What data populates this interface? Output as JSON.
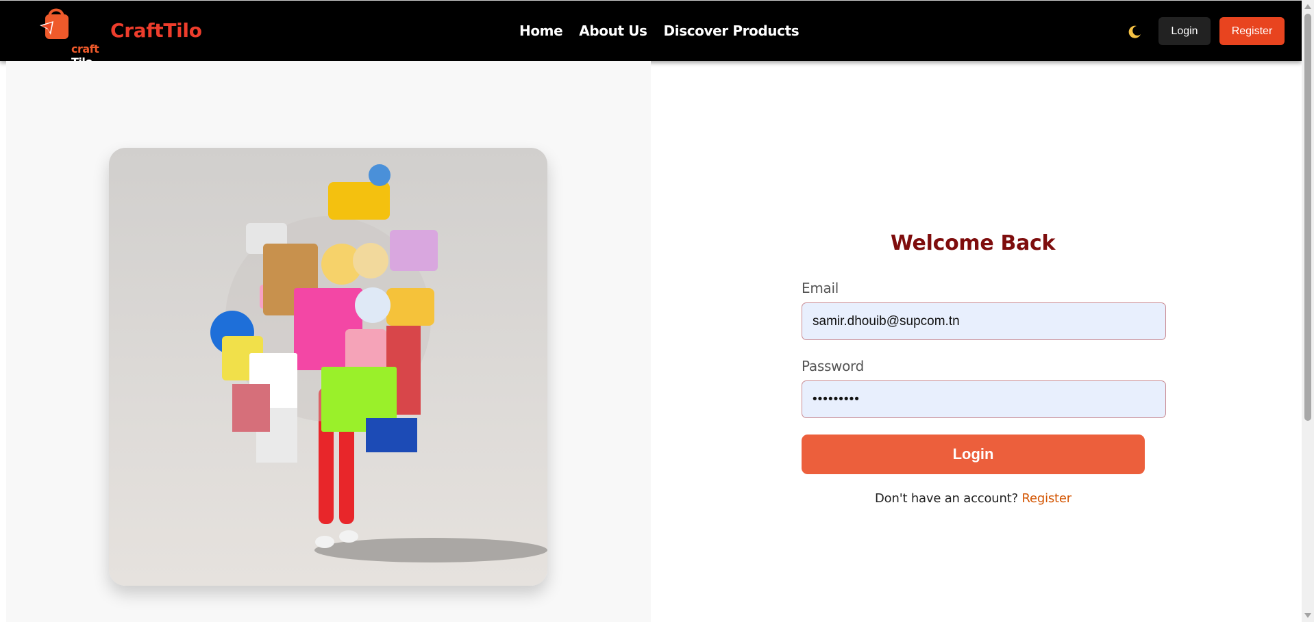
{
  "navbar": {
    "logo_text_1": "craft",
    "logo_text_2": "Tilo",
    "brand": "CraftTilo",
    "links": [
      "Home",
      "About Us",
      "Discover Products"
    ],
    "theme_icon": "moon-icon",
    "login_label": "Login",
    "register_label": "Register"
  },
  "hero": {
    "image": "shopping-bags-illustration"
  },
  "form": {
    "title": "Welcome Back",
    "email_label": "Email",
    "email_value": "samir.dhouib@supcom.tn",
    "password_label": "Password",
    "password_value": "•••••••••",
    "submit_label": "Login",
    "signup_prompt": "Don't have an account?",
    "signup_link": "Register"
  },
  "colors": {
    "navbar_bg": "#000000",
    "brand": "#ee3d2c",
    "accent": "#ec5f3c",
    "title": "#7e0d0d",
    "input_bg": "#e8effd",
    "link": "#d35400"
  }
}
